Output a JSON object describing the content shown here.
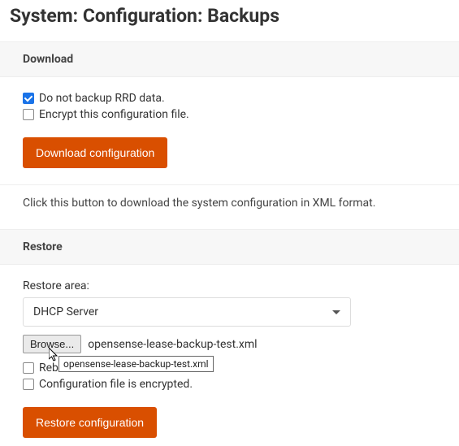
{
  "page": {
    "title": "System: Configuration: Backups"
  },
  "download": {
    "header": "Download",
    "noBackupRrd": {
      "label": "Do not backup RRD data.",
      "checked": true
    },
    "encrypt": {
      "label": "Encrypt this configuration file.",
      "checked": false
    },
    "buttonLabel": "Download configuration",
    "helpText": "Click this button to download the system configuration in XML format."
  },
  "restore": {
    "header": "Restore",
    "areaLabel": "Restore area:",
    "areaSelected": "DHCP Server",
    "browseLabel": "Browse...",
    "filename": "opensense-lease-backup-test.xml",
    "tooltip": "opensense-lease-backup-test.xml",
    "reboot": {
      "label": "Reboot after a successful restore.",
      "checked": false
    },
    "encrypted": {
      "label": "Configuration file is encrypted.",
      "checked": false
    },
    "buttonLabel": "Restore configuration"
  }
}
